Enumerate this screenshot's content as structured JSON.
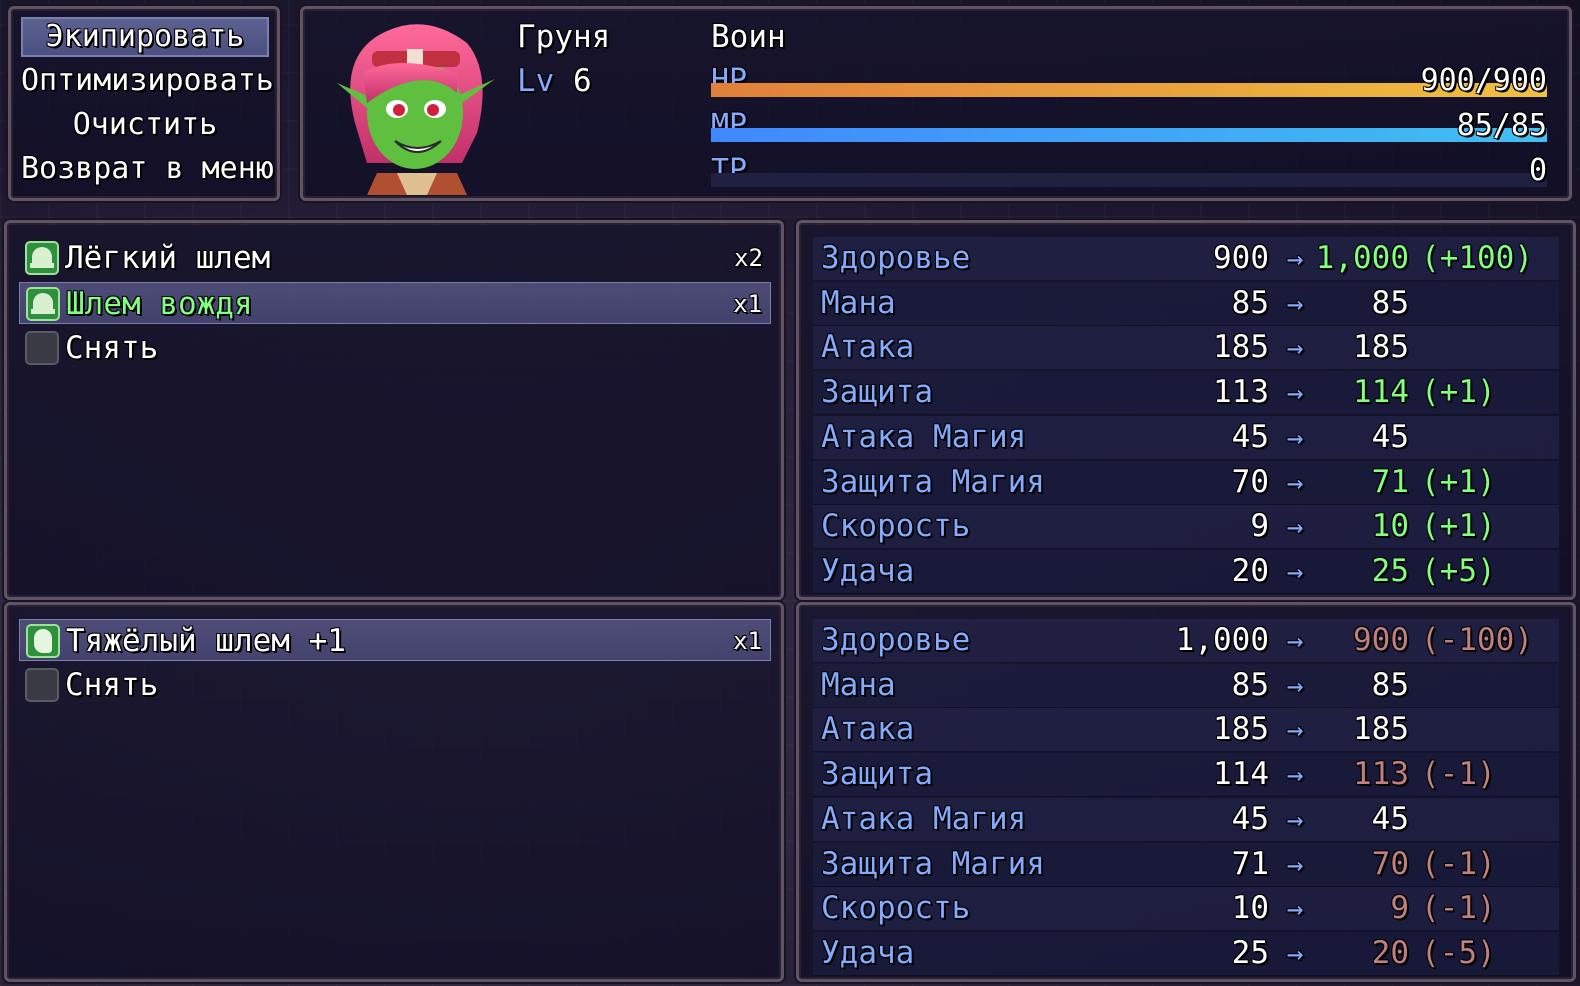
{
  "colors": {
    "system": "#84aaff",
    "power_up": "#80ff80",
    "power_down": "#c08080",
    "hp_gauge": [
      "#e0803a",
      "#f0c040"
    ],
    "mp_gauge": [
      "#4088ff",
      "#40c0f0"
    ],
    "tp_gauge": [
      "#40a040",
      "#80e080"
    ]
  },
  "command": {
    "items": [
      "Экипировать",
      "Оптимизировать",
      "Очистить",
      "Возврат в меню"
    ],
    "selected_index": 0
  },
  "actor": {
    "name": "Груня",
    "class": "Воин",
    "level_label": "Lv",
    "level": "6",
    "hp_label": "HP",
    "hp_value": "900/900",
    "hp_ratio": 1.0,
    "mp_label": "MP",
    "mp_value": "85/85",
    "mp_ratio": 1.0,
    "tp_label": "TP",
    "tp_value": "0",
    "tp_ratio": 0.0
  },
  "list1": {
    "items": [
      {
        "icon": "light-helmet-icon",
        "name": "Лёгкий шлем",
        "count": "x2",
        "highlight": false
      },
      {
        "icon": "chief-helmet-icon",
        "name": "Шлем вождя",
        "count": "x1",
        "highlight": true
      },
      {
        "icon": "empty-slot-icon",
        "name": "Снять",
        "count": ""
      }
    ],
    "selected_index": 1
  },
  "list2": {
    "items": [
      {
        "icon": "heavy-helmet-icon",
        "name": "Тяжёлый шлем +1",
        "count": "x1"
      },
      {
        "icon": "empty-slot-icon",
        "name": "Снять",
        "count": ""
      }
    ],
    "selected_index": 0
  },
  "arrow": "→",
  "params1": [
    {
      "name": "Здоровье",
      "cur": "900",
      "new": "1,000",
      "diff": "(+100)",
      "dir": "up"
    },
    {
      "name": "Мана",
      "cur": "85",
      "new": "85",
      "diff": "",
      "dir": ""
    },
    {
      "name": "Атака",
      "cur": "185",
      "new": "185",
      "diff": "",
      "dir": ""
    },
    {
      "name": "Защита",
      "cur": "113",
      "new": "114",
      "diff": "(+1)",
      "dir": "up"
    },
    {
      "name": "Атака Магия",
      "cur": "45",
      "new": "45",
      "diff": "",
      "dir": ""
    },
    {
      "name": "Защита Магия",
      "cur": "70",
      "new": "71",
      "diff": "(+1)",
      "dir": "up"
    },
    {
      "name": "Скорость",
      "cur": "9",
      "new": "10",
      "diff": "(+1)",
      "dir": "up"
    },
    {
      "name": "Удача",
      "cur": "20",
      "new": "25",
      "diff": "(+5)",
      "dir": "up"
    }
  ],
  "params2": [
    {
      "name": "Здоровье",
      "cur": "1,000",
      "new": "900",
      "diff": "(-100)",
      "dir": "down"
    },
    {
      "name": "Мана",
      "cur": "85",
      "new": "85",
      "diff": "",
      "dir": ""
    },
    {
      "name": "Атака",
      "cur": "185",
      "new": "185",
      "diff": "",
      "dir": ""
    },
    {
      "name": "Защита",
      "cur": "114",
      "new": "113",
      "diff": "(-1)",
      "dir": "down"
    },
    {
      "name": "Атака Магия",
      "cur": "45",
      "new": "45",
      "diff": "",
      "dir": ""
    },
    {
      "name": "Защита Магия",
      "cur": "71",
      "new": "70",
      "diff": "(-1)",
      "dir": "down"
    },
    {
      "name": "Скорость",
      "cur": "10",
      "new": "9",
      "diff": "(-1)",
      "dir": "down"
    },
    {
      "name": "Удача",
      "cur": "25",
      "new": "20",
      "diff": "(-5)",
      "dir": "down"
    }
  ]
}
